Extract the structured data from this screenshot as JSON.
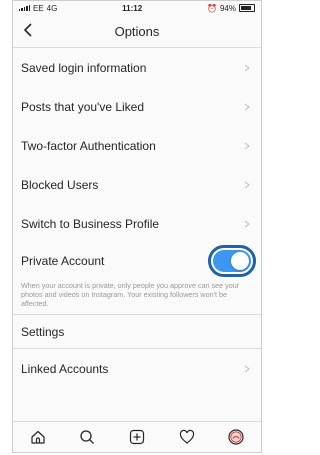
{
  "status_bar": {
    "carrier": "EE",
    "network": "4G",
    "time": "11:12",
    "battery": "94%"
  },
  "header": {
    "title": "Options"
  },
  "items": [
    {
      "label": "Saved login information"
    },
    {
      "label": "Posts that you've Liked"
    },
    {
      "label": "Two-factor Authentication"
    },
    {
      "label": "Blocked Users"
    },
    {
      "label": "Switch to Business Profile"
    }
  ],
  "private_account": {
    "label": "Private Account",
    "enabled": true,
    "description": "When your account is private, only people you approve can see your photos and videos on Instagram. Your existing followers won't be affected."
  },
  "settings_section": {
    "title": "Settings"
  },
  "settings_items": [
    {
      "label": "Linked Accounts"
    }
  ],
  "colors": {
    "toggle_on": "#3d97f0",
    "highlight_ring": "#1f62a9"
  },
  "tab_bar": [
    "home-icon",
    "search-icon",
    "add-post-icon",
    "heart-icon",
    "profile-icon"
  ]
}
